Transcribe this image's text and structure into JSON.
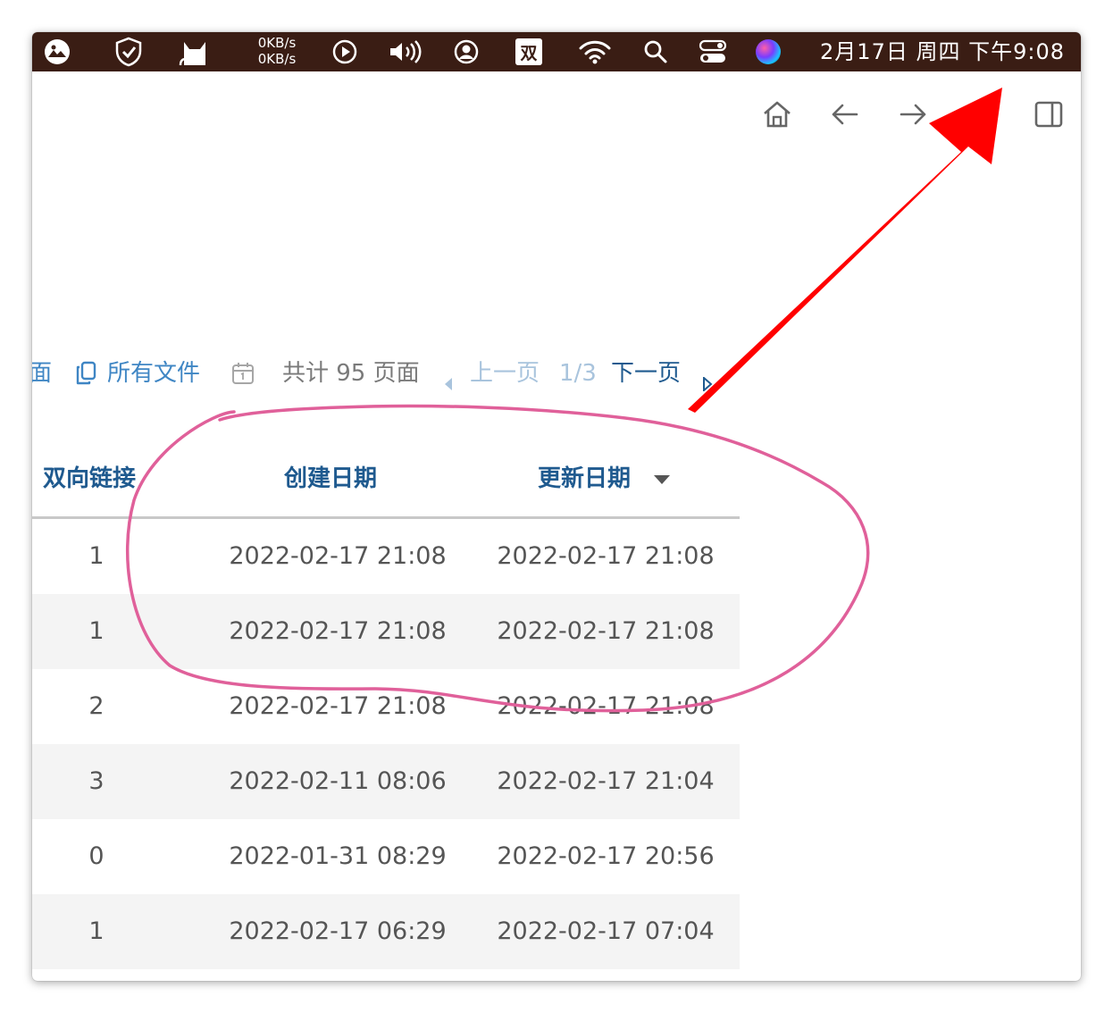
{
  "menubar": {
    "icons": [
      "photo-widget-icon",
      "shield-check-icon",
      "cat-icon",
      "network-speed",
      "play-circle-icon",
      "volume-icon",
      "user-circle-icon",
      "input-method-icon",
      "wifi-icon",
      "search-icon",
      "control-center-icon",
      "siri-icon"
    ],
    "net_up": "0KB/s",
    "net_down": "0KB/s",
    "input_method": "双",
    "clock": "2月17日 周四 下午9:08",
    "background": "#3a1d14"
  },
  "toolbar": {
    "icons": [
      "home-icon",
      "back-arrow-icon",
      "forward-arrow-icon",
      "sidebar-toggle-icon"
    ]
  },
  "pager": {
    "partial_tab": "面",
    "all_files_label": "所有文件",
    "total_label": "共计 95 页面",
    "prev_label": "上一页",
    "page_indicator": "1/3",
    "next_label": "下一页"
  },
  "table": {
    "columns": [
      "双向链接",
      "创建日期",
      "更新日期"
    ],
    "sorted_column": "更新日期",
    "sort_direction": "descending",
    "rows": [
      {
        "links": "1",
        "created": "2022-02-17 21:08",
        "updated": "2022-02-17 21:08"
      },
      {
        "links": "1",
        "created": "2022-02-17 21:08",
        "updated": "2022-02-17 21:08"
      },
      {
        "links": "2",
        "created": "2022-02-17 21:08",
        "updated": "2022-02-17 21:08"
      },
      {
        "links": "3",
        "created": "2022-02-11 08:06",
        "updated": "2022-02-17 21:04"
      },
      {
        "links": "0",
        "created": "2022-01-31 08:29",
        "updated": "2022-02-17 20:56"
      },
      {
        "links": "1",
        "created": "2022-02-17 06:29",
        "updated": "2022-02-17 07:04"
      }
    ]
  },
  "colors": {
    "header_text": "#1f5a8f",
    "link_text": "#3f86c4",
    "annotation_arrow": "#ff0000",
    "annotation_circle": "#e0609a"
  }
}
